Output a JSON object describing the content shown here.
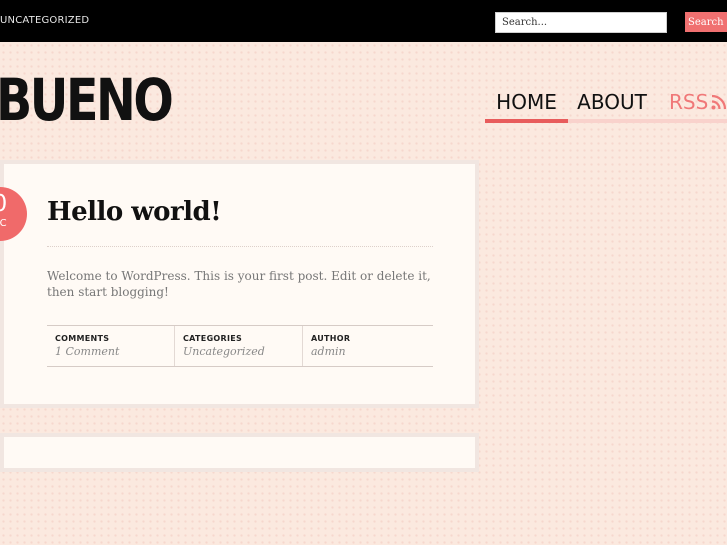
{
  "topbar": {
    "category_link": "Uncategorized",
    "search": {
      "placeholder": "Search...",
      "button_label": "Search"
    }
  },
  "site": {
    "logo": "BUENO"
  },
  "nav": {
    "items": [
      {
        "label": "HOME",
        "active": true
      },
      {
        "label": "ABOUT",
        "active": false
      },
      {
        "label": "RSS",
        "icon": "rss-icon"
      }
    ]
  },
  "post": {
    "date": {
      "day": "0",
      "month": "EC"
    },
    "title": "Hello world!",
    "excerpt": "Welcome to WordPress. This is your first post. Edit or delete it, then start blogging!",
    "meta": {
      "comments": {
        "label": "Comments",
        "value": "1 Comment"
      },
      "categories": {
        "label": "Categories",
        "value": "Uncategorized"
      },
      "author": {
        "label": "Author",
        "value": "admin"
      }
    }
  },
  "colors": {
    "accent": "#f06a6a",
    "topbar": "#000000",
    "background": "#fbe9df",
    "card": "#fffaf5"
  }
}
